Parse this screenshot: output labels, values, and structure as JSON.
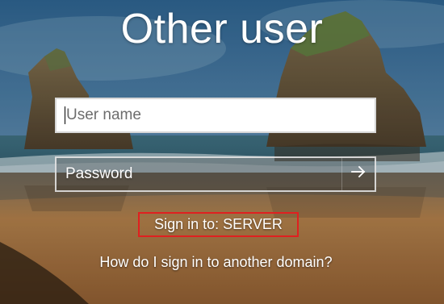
{
  "login": {
    "title": "Other user",
    "username_placeholder": "User name",
    "password_placeholder": "Password",
    "sign_in_to": "Sign in to: SERVER",
    "help_link": "How do I sign in to another domain?"
  },
  "icons": {
    "submit": "arrow-right-icon"
  },
  "colors": {
    "highlight_box": "#e02020",
    "text": "#ffffff",
    "field_bg": "#ffffff",
    "sky_top": "#2c5f8a",
    "sand": "#a87947"
  }
}
